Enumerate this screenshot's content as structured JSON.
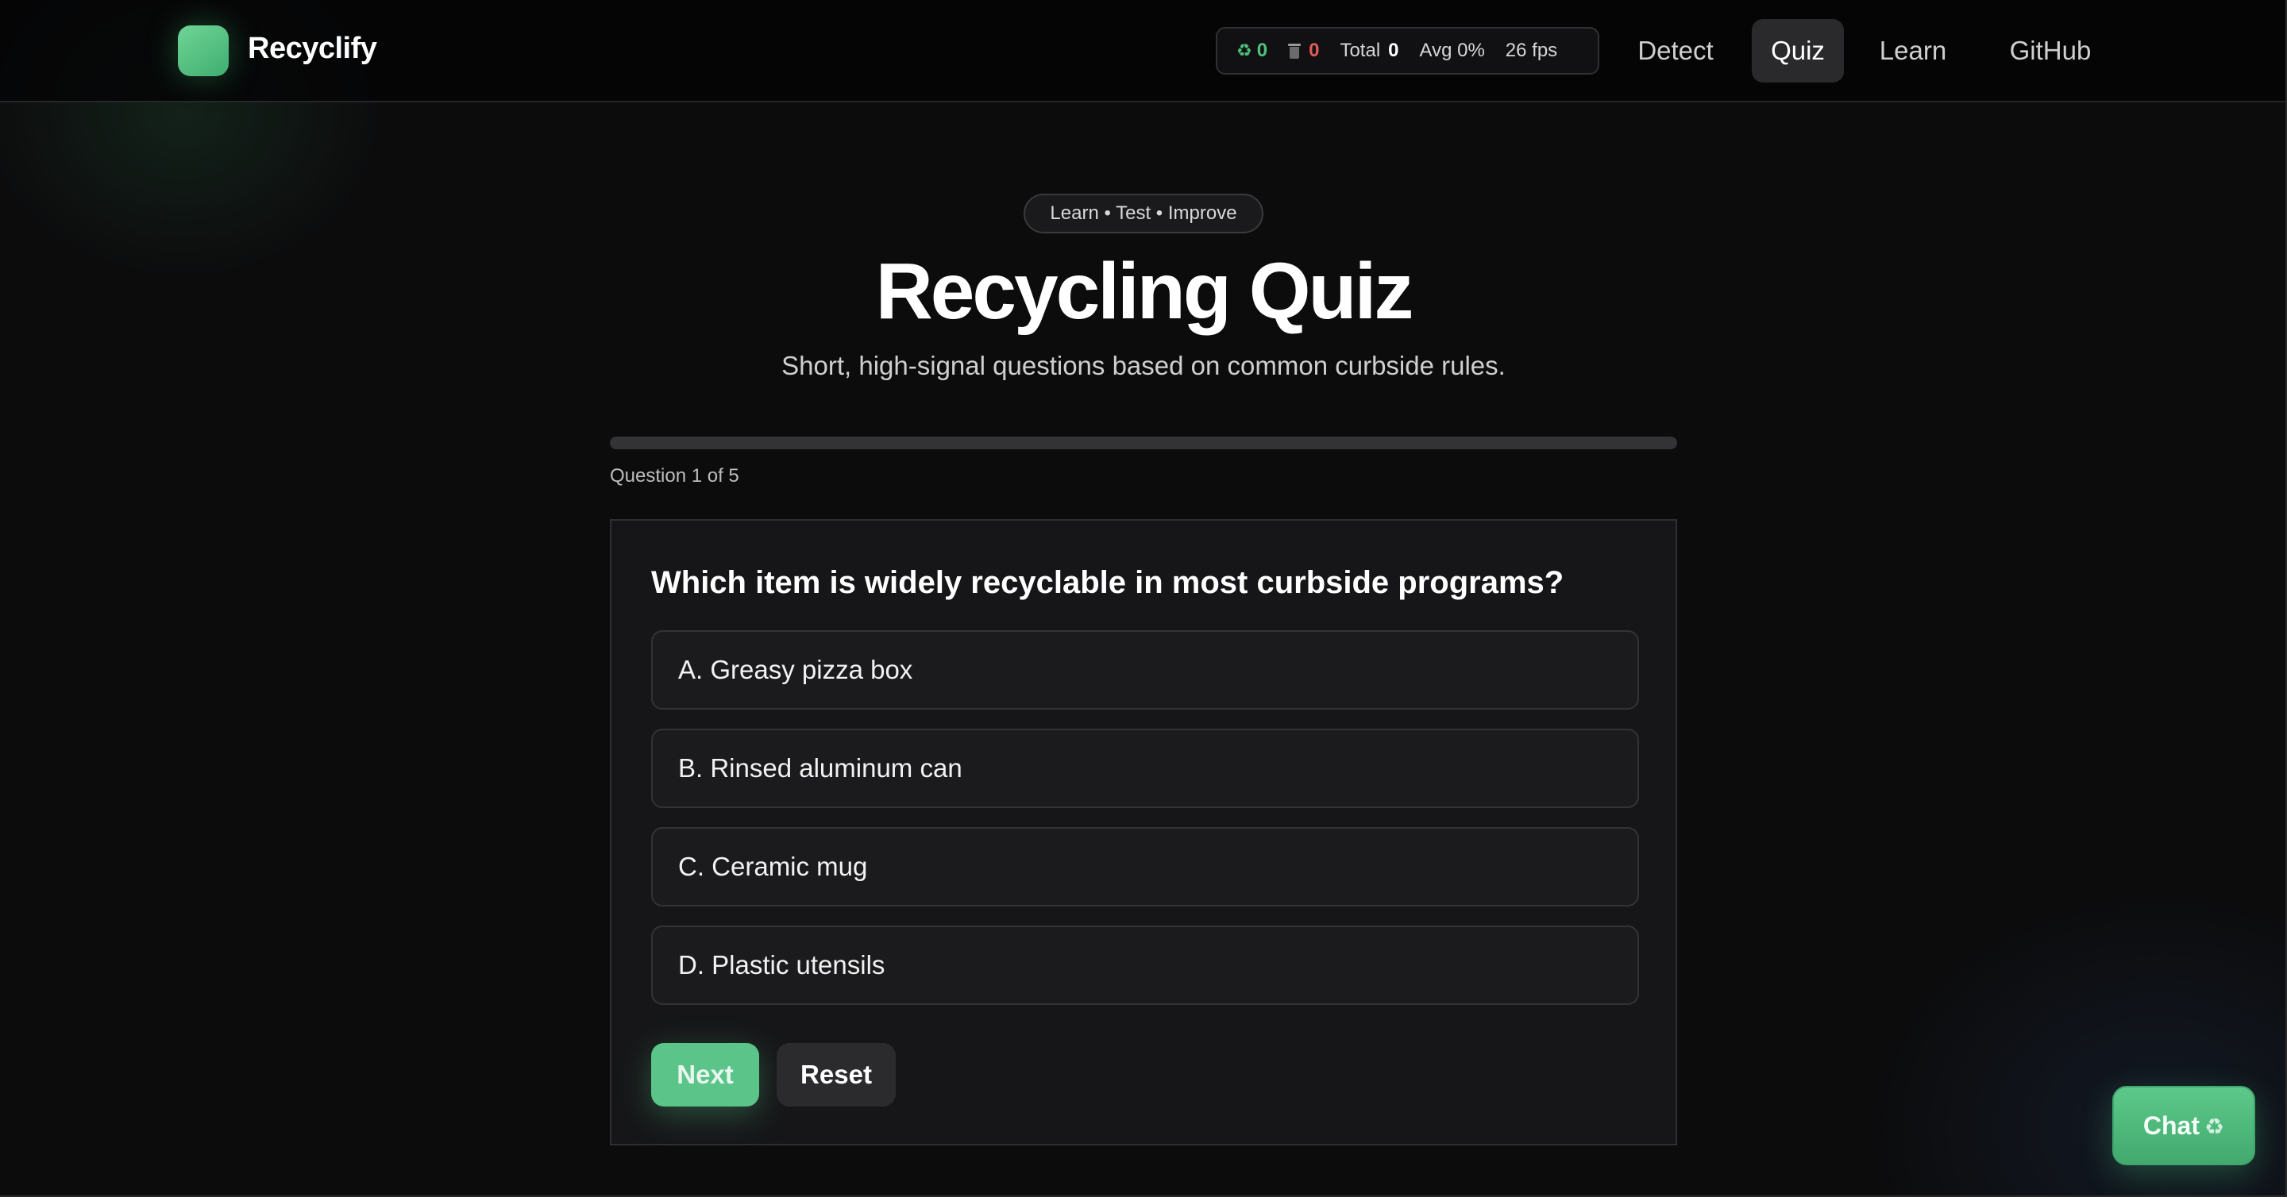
{
  "app": {
    "brand": "Recyclify"
  },
  "stats": {
    "recycle_icon": "♻",
    "recycle_count": "0",
    "trash_count": "0",
    "total_label": "Total",
    "total_value": "0",
    "avg": "Avg 0%",
    "fps": "26 fps"
  },
  "nav": {
    "items": [
      {
        "label": "Detect"
      },
      {
        "label": "Quiz"
      },
      {
        "label": "Learn"
      },
      {
        "label": "GitHub"
      }
    ],
    "active": "Quiz"
  },
  "hero": {
    "pill": "Learn • Test • Improve",
    "title": "Recycling Quiz",
    "subtitle": "Short, high-signal questions based on common curbside rules."
  },
  "quiz": {
    "progress_fraction": 0,
    "counter": "Question 1 of 5",
    "question": "Which item is widely recyclable in most curbside programs?",
    "options": [
      {
        "label": "A. Greasy pizza box"
      },
      {
        "label": "B. Rinsed aluminum can"
      },
      {
        "label": "C. Ceramic mug"
      },
      {
        "label": "D. Plastic utensils"
      }
    ],
    "next_label": "Next",
    "reset_label": "Reset"
  },
  "chat": {
    "label": "Chat",
    "icon": "♻"
  },
  "colors": {
    "accent": "#5ac489",
    "danger": "#e35a5a",
    "background": "#0c0c0d"
  }
}
